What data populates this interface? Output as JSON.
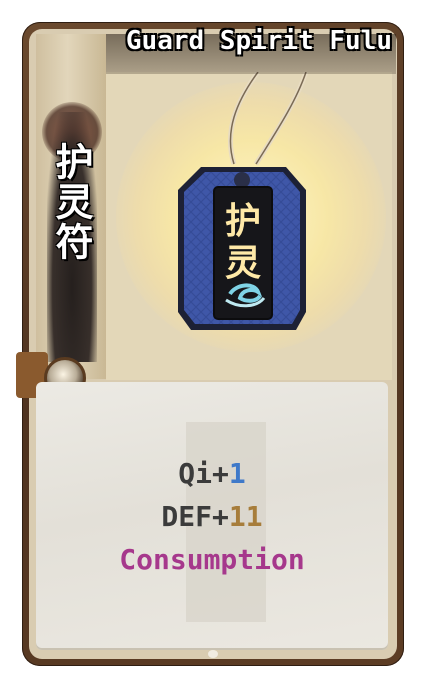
{
  "card": {
    "title": "Guard Spirit Fulu",
    "vertical_name": "护灵符",
    "talisman_text": [
      "护",
      "灵"
    ],
    "stats": [
      {
        "label": "Qi+",
        "value": "1",
        "value_color": "#3f79c9"
      },
      {
        "label": "DEF+",
        "value": "11",
        "value_color": "#a77d3b"
      }
    ],
    "keyword": "Consumption",
    "keyword_color": "#a6388c"
  }
}
